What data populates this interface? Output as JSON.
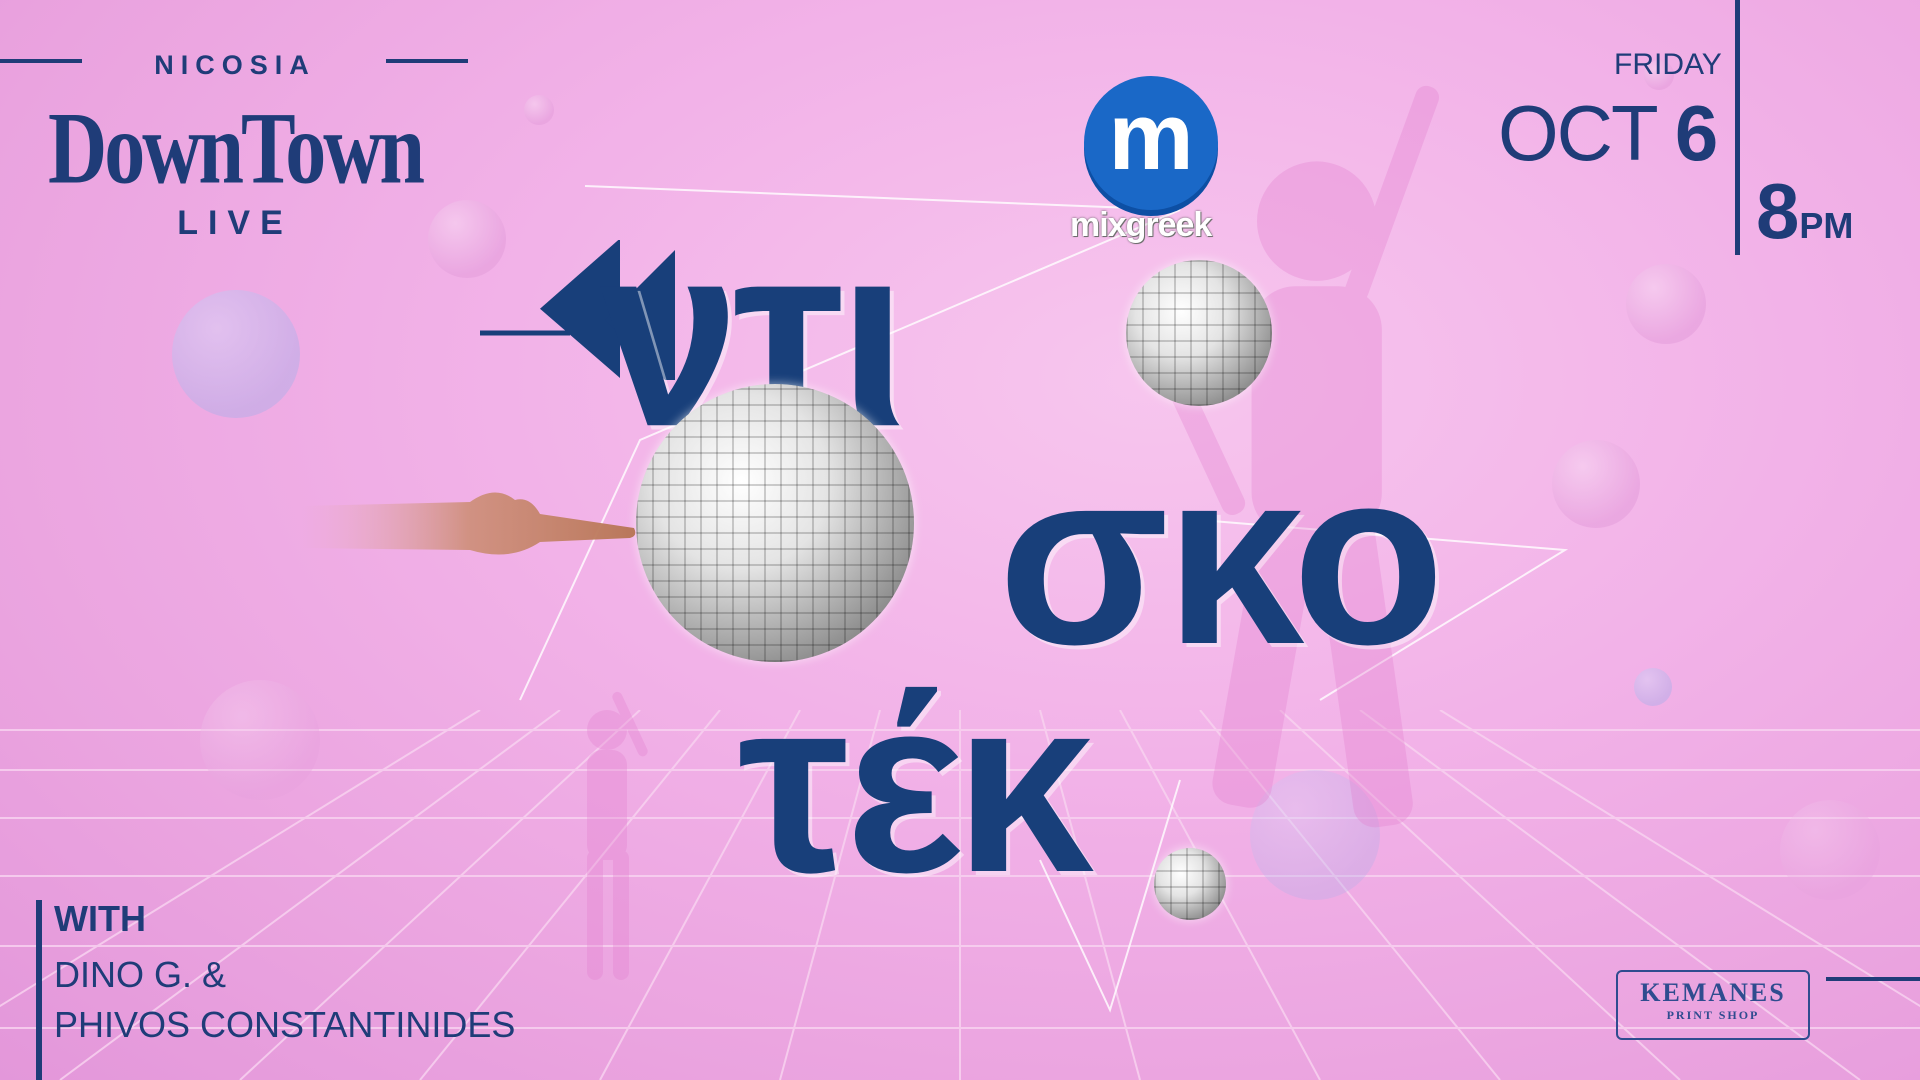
{
  "venue": {
    "top": "NICOSIA",
    "name": "DownTown",
    "bottom": "LIVE"
  },
  "sponsor": {
    "logo_letter": "m",
    "wordmark": "mixgreek"
  },
  "event": {
    "day": "FRIDAY",
    "month": "OCT",
    "date": "6",
    "time": "8",
    "ampm": "PM"
  },
  "title": {
    "line1": "ντι",
    "line2": "σκο",
    "line3": "τέκ"
  },
  "performers": {
    "label": "WITH",
    "line1": "DINO G. &",
    "line2": "PHIVOS CONSTANTINIDES"
  },
  "print_shop": {
    "name": "KEMANES",
    "sub": "PRINT SHOP"
  },
  "colors": {
    "brand_navy": "#1f3c78",
    "background_pink": "#f2b2e8",
    "mixgreek_blue": "#1a68c7"
  }
}
